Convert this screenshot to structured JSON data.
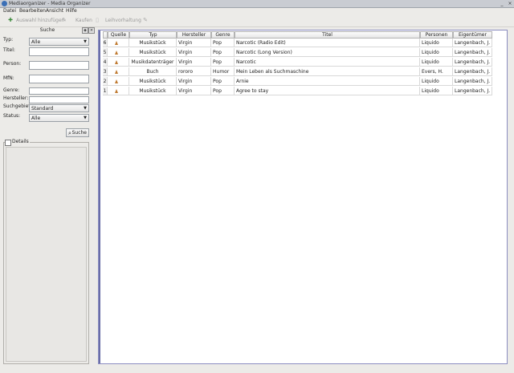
{
  "window": {
    "title": "Mediaorganizer - Media Organizer",
    "minimize": "_",
    "close": "×"
  },
  "menu": [
    "Datei",
    "Bearbeiten",
    "Ansicht",
    "Hilfe"
  ],
  "toolbar": {
    "add_label": "Auswahl hinzufügen",
    "buy_label": "Kaufen",
    "lend_label": "Leihvorhaltung"
  },
  "search_panel": {
    "title": "Suche",
    "fields": {
      "typ": {
        "label": "Typ:",
        "value": "Alle"
      },
      "titel": {
        "label": "Titel:",
        "value": ""
      },
      "person": {
        "label": "Person:",
        "value": ""
      },
      "mfn": {
        "label": "MfN:",
        "value": ""
      },
      "genre": {
        "label": "Genre:",
        "value": ""
      },
      "hersteller": {
        "label": "Hersteller:",
        "value": ""
      },
      "suchgebiet": {
        "label": "Suchgebiet:",
        "value": "Standard"
      },
      "status": {
        "label": "Status:",
        "value": "Alle"
      }
    },
    "search_button": "Suche",
    "details_label": "Details"
  },
  "table": {
    "columns": [
      "Quelle",
      "Typ",
      "Hersteller",
      "Genre",
      "Titel",
      "Personen",
      "Eigentümer"
    ],
    "rows": [
      {
        "num": "6",
        "typ": "Musikstück",
        "hersteller": "Virgin",
        "genre": "Pop",
        "titel": "Narcotic (Radio Edit)",
        "personen": "Liquido",
        "eigentuemer": "Langenbach, J."
      },
      {
        "num": "5",
        "typ": "Musikstück",
        "hersteller": "Virgin",
        "genre": "Pop",
        "titel": "Narcotic (Long Version)",
        "personen": "Liquido",
        "eigentuemer": "Langenbach, J."
      },
      {
        "num": "4",
        "typ": "Musikdatenträger",
        "hersteller": "Virgin",
        "genre": "Pop",
        "titel": "Narcotic",
        "personen": "Liquido",
        "eigentuemer": "Langenbach, J."
      },
      {
        "num": "3",
        "typ": "Buch",
        "hersteller": "rororo",
        "genre": "Humor",
        "titel": "Mein Leben als Suchmaschine",
        "personen": "Evers, H.",
        "eigentuemer": "Langenbach, J."
      },
      {
        "num": "2",
        "typ": "Musikstück",
        "hersteller": "Virgin",
        "genre": "Pop",
        "titel": "Arnie",
        "personen": "Liquido",
        "eigentuemer": "Langenbach, J."
      },
      {
        "num": "1",
        "typ": "Musikstück",
        "hersteller": "Virgin",
        "genre": "Pop",
        "titel": "Agree to stay",
        "personen": "Liquido",
        "eigentuemer": "Langenbach, J."
      }
    ]
  },
  "colors": {
    "accent": "#3b6fb6",
    "table_border": "#8a8cc0",
    "source_icon": "#c07a30"
  }
}
